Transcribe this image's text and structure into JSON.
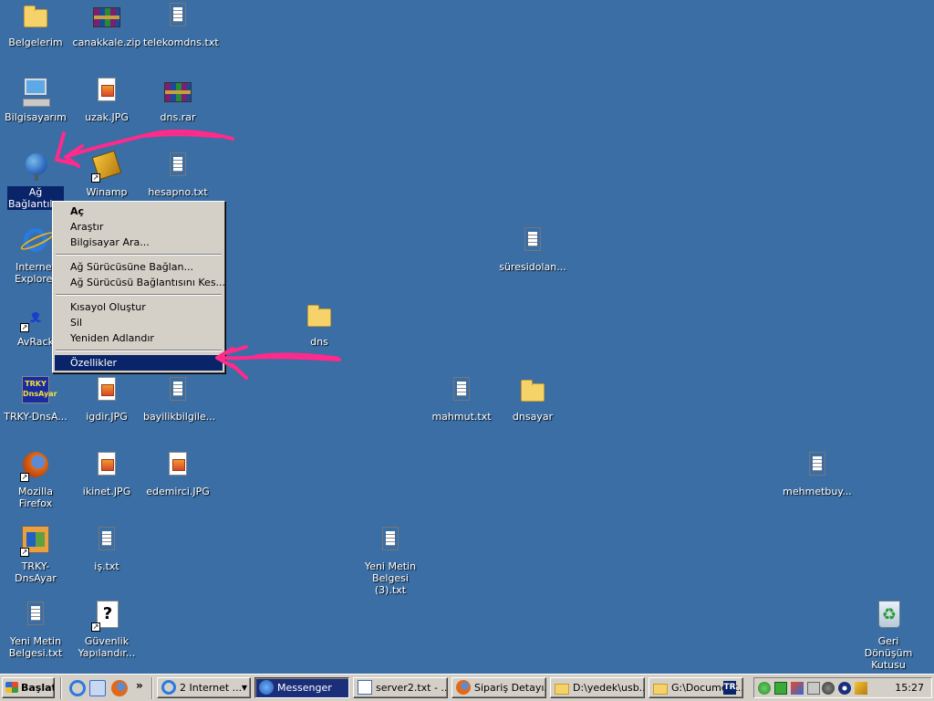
{
  "desktop_icons": {
    "belgelerim": "Belgelerim",
    "canakkale": "canakkale.zip",
    "telekomdns": "telekomdns.txt",
    "bilgisayarim": "Bilgisayarım",
    "uzak": "uzak.JPG",
    "dnsrar": "dns.rar",
    "ag_baglantilari": "Ağ Bağlantıları",
    "winamp": "Winamp",
    "hesapno": "hesapno.txt",
    "internet_explorer": "Internet Explorer",
    "suresidolan": "süresidolan...",
    "avrack": "AvRack",
    "dns_folder": "dns",
    "trky_dnsa": "TRKY-DnsA...",
    "igdir": "igdir.JPG",
    "bayilik": "bayilikbilgile...",
    "mahmut": "mahmut.txt",
    "dnsayar": "dnsayar",
    "firefox": "Mozilla Firefox",
    "ikinet": "ikinet.JPG",
    "edemirci": "edemirci.JPG",
    "mehmetbuy": "mehmetbuy...",
    "trky_dnsayar": "TRKY-DnsAyar",
    "is_txt": "iş.txt",
    "yeni_metin3": "Yeni Metin Belgesi (3).txt",
    "yeni_metin": "Yeni Metin Belgesi.txt",
    "guvenlik": "Güvenlik Yapılandır...",
    "geri_donusum": "Geri Dönüşüm Kutusu",
    "trky_logo_text": "TRKY DnsAyar"
  },
  "context_menu": {
    "open": "Aç",
    "explore": "Araştır",
    "search_computer": "Bilgisayar Ara...",
    "map_drive": "Ağ Sürücüsüne Bağlan...",
    "disconnect_drive": "Ağ Sürücüsü Bağlantısını Kes...",
    "create_shortcut": "Kısayol Oluştur",
    "delete": "Sil",
    "rename": "Yeniden Adlandır",
    "properties": "Özellikler"
  },
  "taskbar": {
    "start": "Başlat",
    "overflow": "»",
    "buttons": {
      "internet": "2 Internet ...",
      "messenger": "Messenger",
      "server2": "server2.txt - ...",
      "siparis": "Sipariş Detayı...",
      "yedek": "D:\\yedek\\usb...",
      "documents": "G:\\Document..."
    },
    "language": "TR",
    "clock": "15:27"
  },
  "icons": {
    "start": "windows-logo-icon",
    "folder": "folder-icon",
    "text_file": "text-file-icon",
    "archive": "rar-archive-icon",
    "image_file": "jpg-file-icon",
    "computer": "my-computer-icon",
    "network": "network-globe-icon",
    "browser_ie": "internet-explorer-icon",
    "browser_ff": "firefox-icon",
    "recycle": "recycle-bin-icon"
  },
  "colors": {
    "desktop": "#3A6EA5",
    "selection": "#0A246A",
    "menu_bg": "#D4D0C8",
    "annotation": "#FF2A8A"
  }
}
